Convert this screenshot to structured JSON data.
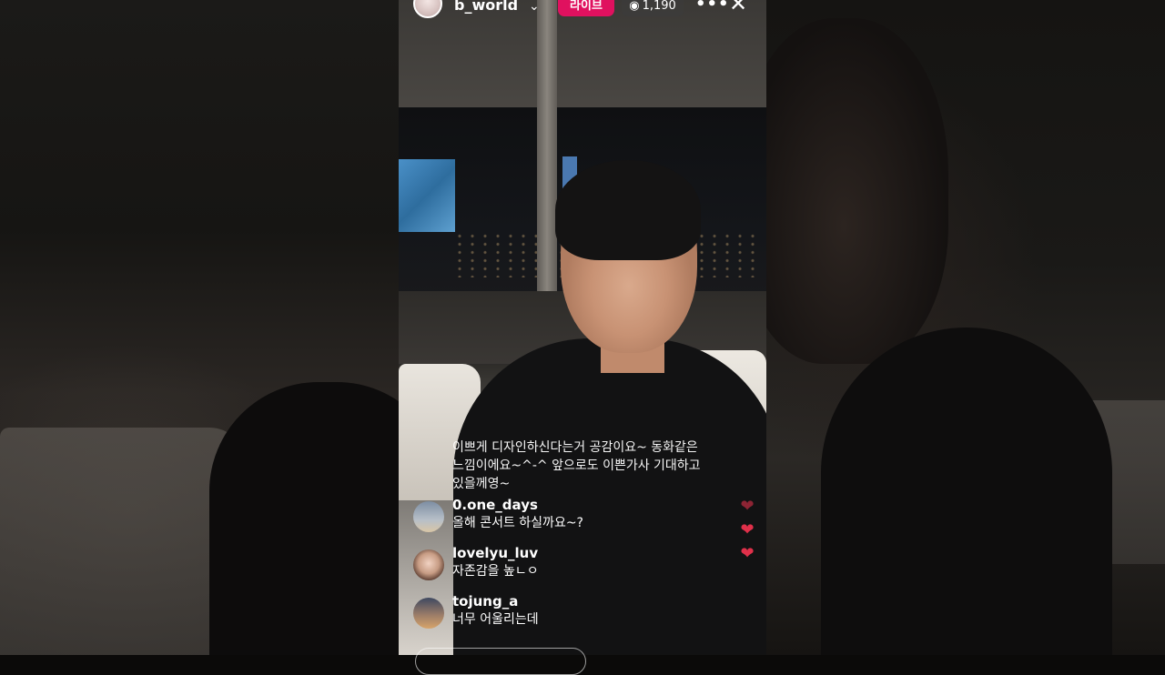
{
  "header": {
    "username": "b_world",
    "live_label": "라이브",
    "viewer_count": "1,190",
    "icons": [
      "chevron-down-icon",
      "eye-icon",
      "more-icon",
      "close-icon"
    ]
  },
  "pinned_comment": {
    "line1": "이쁘게 디자인하신다는거 공감이요~ 동화같은",
    "line2": "느낌이에요~^-^ 앞으로도 이쁜가사 기대하고",
    "line3": "있을께영~"
  },
  "comments": [
    {
      "username": "0.one_days",
      "text": "올해 콘서트 하실까요~?"
    },
    {
      "username": "lovelyu_luv",
      "text": "자존감을 높ㄴㅇ"
    },
    {
      "username": "tojung_a",
      "text": "너무 어울리는데"
    }
  ],
  "colors": {
    "live_badge": "#e0115f",
    "heart": "#e0304a"
  }
}
